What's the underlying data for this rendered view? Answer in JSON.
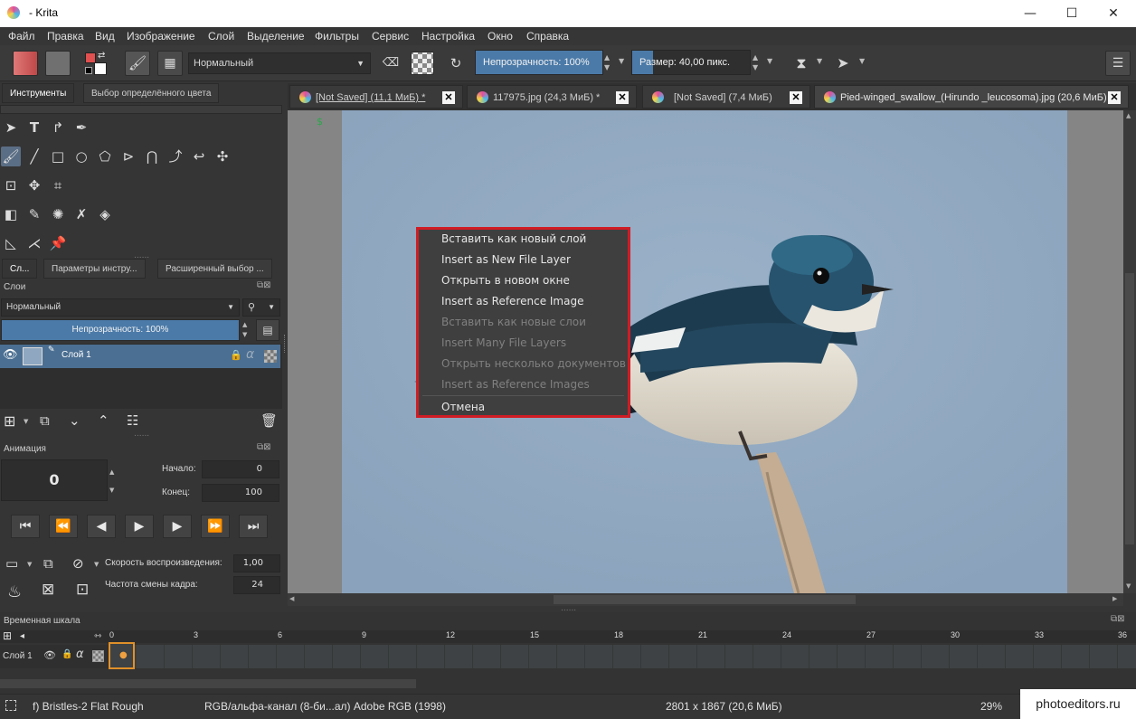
{
  "window": {
    "title": "- Krita",
    "controls": [
      "—",
      "☐",
      "✕"
    ]
  },
  "menu": [
    "Файл",
    "Правка",
    "Вид",
    "Изображение",
    "Слой",
    "Выделение",
    "Фильтры",
    "Сервис",
    "Настройка",
    "Окно",
    "Справка"
  ],
  "toolbar": {
    "blend_mode": "Нормальный",
    "opacity": "Непрозрачность: 100%",
    "opacity_value": 1.0,
    "size": "Размер: 40,00 пикс.",
    "size_value": 0.18
  },
  "left_dock": {
    "tabs": [
      "Инструменты",
      "Выбор определённого цвета"
    ],
    "layer_tabs": [
      "Сл...",
      "Параметры инстру...",
      "Расширенный выбор ..."
    ],
    "layers_title": "Слои",
    "layers_blend": "Нормальный",
    "layers_opacity": "Непрозрачность:  100%",
    "layer_name": "Слой 1",
    "animation_title": "Анимация",
    "current_frame": "0",
    "start_label": "Начало:",
    "start_value": "0",
    "end_label": "Конец:",
    "end_value": "100",
    "speed_label": "Скорость воспроизведения:",
    "speed_value": "1,00",
    "fps_label": "Частота смены кадра:",
    "fps_value": "24"
  },
  "doc_tabs": [
    {
      "label": "[Not Saved]  (11,1 МиБ) *"
    },
    {
      "label": "117975.jpg (24,3 МиБ) *"
    },
    {
      "label": "[Not Saved]  (7,4 МиБ)"
    },
    {
      "label": "Pied-winged_swallow_(Hirundo _leucosoma).jpg (20,6 МиБ)"
    }
  ],
  "context_menu": {
    "items": [
      {
        "label": "Вставить как новый слой",
        "enabled": true
      },
      {
        "label": "Insert as New File Layer",
        "enabled": true
      },
      {
        "label": "Открыть в новом окне",
        "enabled": true
      },
      {
        "label": "Insert as Reference Image",
        "enabled": true
      },
      {
        "label": "Вставить как новые слои",
        "enabled": false
      },
      {
        "label": "Insert Many File Layers",
        "enabled": false
      },
      {
        "label": "Открыть несколько документов",
        "enabled": false
      },
      {
        "label": "Insert as Reference Images",
        "enabled": false
      }
    ],
    "cancel": "Отмена"
  },
  "timeline": {
    "title": "Временная шкала",
    "layer": "Слой 1",
    "ticks": [
      "0",
      "3",
      "6",
      "9",
      "12",
      "15",
      "18",
      "21",
      "24",
      "27",
      "30",
      "33",
      "36"
    ]
  },
  "status": {
    "brush": "f) Bristles-2 Flat Rough",
    "color_space": "RGB/альфа-канал (8-би...ал)  Adobe RGB (1998)",
    "dimensions": "2801 x 1867 (20,6 МиБ)",
    "zoom": "29%"
  },
  "watermark": "photoeditors.ru",
  "colors": {
    "accent": "#4b7aa8",
    "highlight_border": "#d01c24",
    "sky": "#8fa7c0"
  }
}
